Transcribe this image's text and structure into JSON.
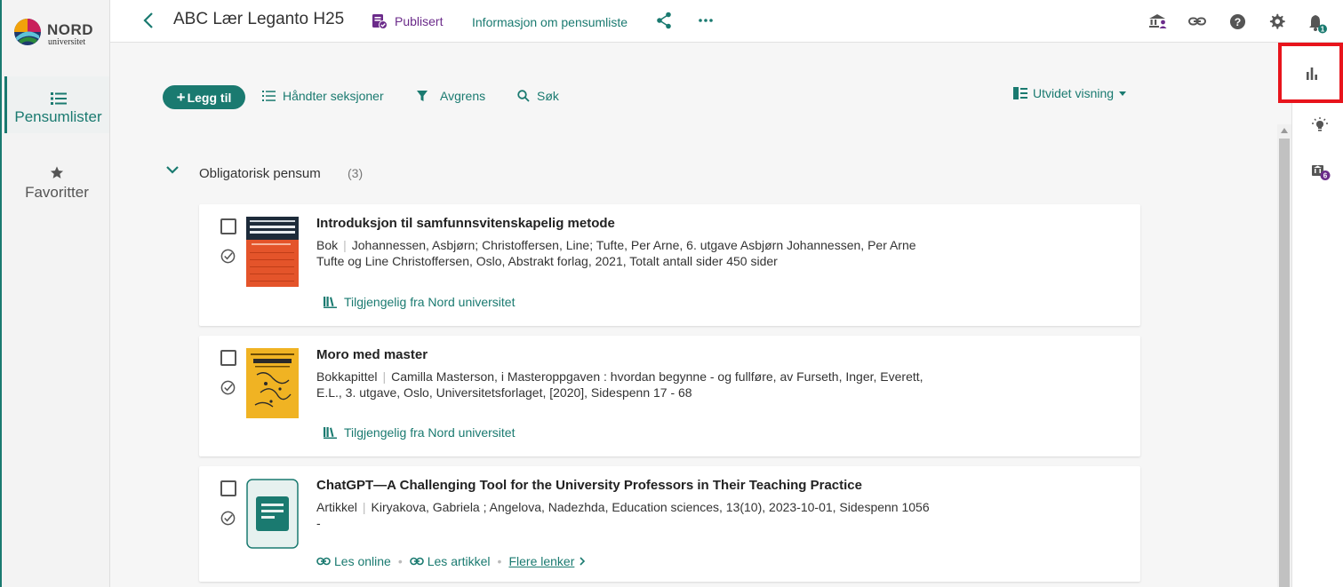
{
  "app": {
    "logo_name": "NORD",
    "logo_sub": "universitet"
  },
  "leftnav": {
    "items": [
      {
        "label": "Pensumlister",
        "icon": "list-icon",
        "active": true
      },
      {
        "label": "Favoritter",
        "icon": "star-icon",
        "active": false
      }
    ]
  },
  "header": {
    "title": "ABC Lær Leganto H25",
    "status": "Publisert",
    "info_link": "Informasjon om pensumliste",
    "notification_count": "1"
  },
  "right_rail": {
    "badge_count": "6"
  },
  "toolbar": {
    "add_label": "Legg til",
    "manage_sections": "Håndter seksjoner",
    "filter": "Avgrens",
    "search": "Søk",
    "view": "Utvidet visning"
  },
  "section": {
    "name": "Obligatorisk pensum",
    "count": "(3)"
  },
  "items": [
    {
      "title": "Introduksjon til samfunnsvitenskapelig metode",
      "type": "Bok",
      "meta": "Johannessen, Asbjørn; Christoffersen, Line; Tufte, Per Arne, 6. utgave Asbjørn Johannessen, Per Arne Tufte og Line Christoffersen, Oslo, Abstrakt forlag, 2021, Totalt antall sider 450 sider",
      "availability": "Tilgjengelig fra Nord universitet"
    },
    {
      "title": "Moro med master",
      "type": "Bokkapittel",
      "meta": "Camilla Masterson, i Masteroppgaven : hvordan begynne - og fullføre, av Furseth, Inger, Everett, E.L., 3. utgave, Oslo, Universitetsforlaget, [2020], Sidespenn 17 - 68",
      "availability": "Tilgjengelig fra Nord universitet"
    },
    {
      "title": "ChatGPT—A Challenging Tool for the University Professors in Their Teaching Practice",
      "type": "Artikkel",
      "meta": "Kiryakova, Gabriela ; Angelova, Nadezhda, Education sciences, 13(10), 2023-10-01, Sidespenn 1056 -",
      "link_online": "Les online",
      "link_article": "Les artikkel",
      "link_more": "Flere lenker"
    }
  ],
  "colors": {
    "primary": "#1a7a70",
    "published": "#6b2b8a",
    "highlight_box": "#e8141c"
  }
}
